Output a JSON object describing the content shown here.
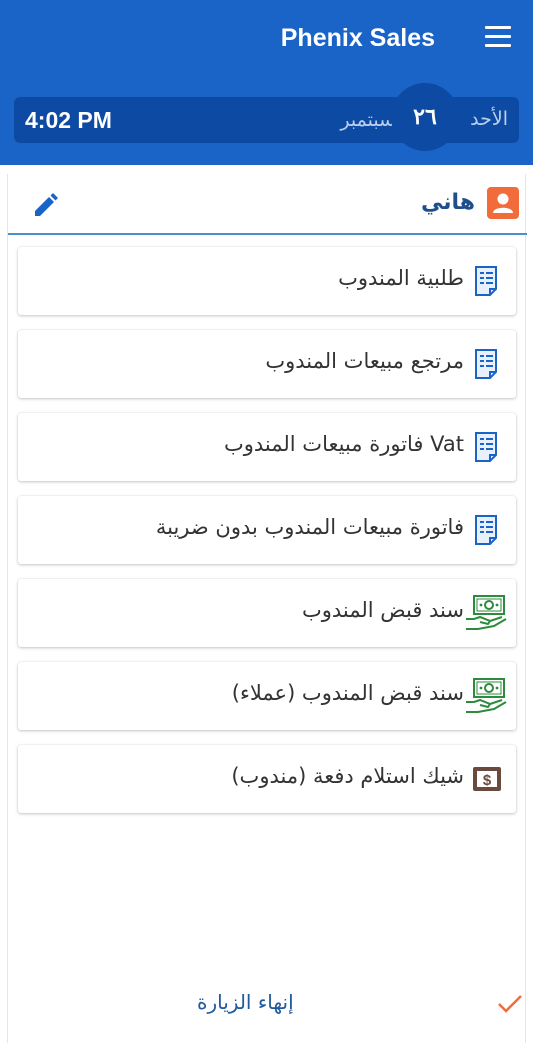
{
  "header": {
    "title": "Phenix Sales",
    "menu_icon": "menu-icon",
    "background": "#1a64c8"
  },
  "date_bar": {
    "time": "4:02 PM",
    "day": "٢٦",
    "month": "سبتمبر",
    "weekday": "الأحد"
  },
  "client": {
    "name": "هاني",
    "avatar_icon": "person-icon",
    "edit_icon": "pencil-icon"
  },
  "menu_items": [
    {
      "label": "طلبية المندوب",
      "icon": "document-icon"
    },
    {
      "label": "مرتجع مبيعات المندوب",
      "icon": "document-icon"
    },
    {
      "label": "فاتورة مبيعات المندوب Vat",
      "icon": "document-icon"
    },
    {
      "label": "فاتورة مبيعات المندوب بدون ضريبة",
      "icon": "document-icon"
    },
    {
      "label": "سند قبض المندوب",
      "icon": "cash-hand-icon"
    },
    {
      "label": "سند قبض المندوب (عملاء)",
      "icon": "cash-hand-icon"
    },
    {
      "label": "شيك استلام دفعة (مندوب)",
      "icon": "dollar-box-icon"
    }
  ],
  "footer": {
    "end_visit_label": "إنهاء الزيارة",
    "check_icon": "check-icon",
    "accent": "#f26b3a"
  }
}
